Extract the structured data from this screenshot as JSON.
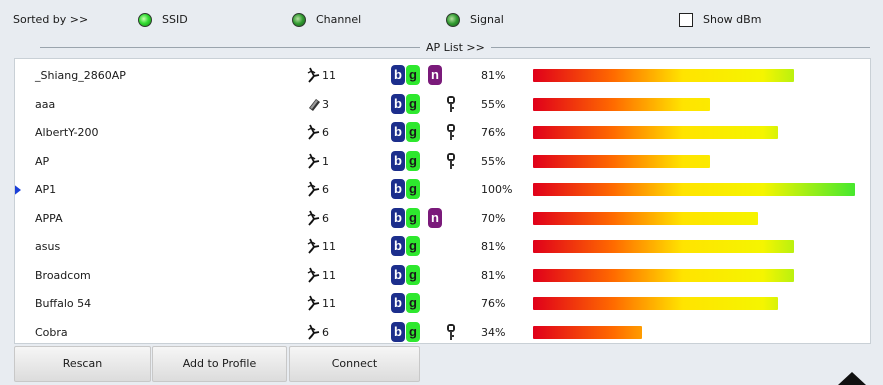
{
  "sortbar": {
    "label": "Sorted by >>",
    "ssid": "SSID",
    "channel": "Channel",
    "signal": "Signal",
    "show_dbm": "Show dBm",
    "ssid_selected": true,
    "show_dbm_checked": false
  },
  "ap_list_label": "AP List >>",
  "colors": {
    "b_badge": "#1c2e8c",
    "g_badge": "#2ee82e",
    "n_badge": "#7a1a7a",
    "selected_arrow": "#1a3fd8"
  },
  "rows": [
    {
      "ssid": "_Shiang_2860AP",
      "channel": "11",
      "channel_icon": "wireless-ap-icon",
      "b": true,
      "g": true,
      "n": true,
      "secured": false,
      "signal": "81%",
      "signal_value": 81,
      "selected": false
    },
    {
      "ssid": "aaa",
      "channel": "3",
      "channel_icon": "adhoc-device-icon",
      "b": true,
      "g": true,
      "n": false,
      "secured": true,
      "signal": "55%",
      "signal_value": 55,
      "selected": false
    },
    {
      "ssid": "AlbertY-200",
      "channel": "6",
      "channel_icon": "wireless-ap-icon",
      "b": true,
      "g": true,
      "n": false,
      "secured": true,
      "signal": "76%",
      "signal_value": 76,
      "selected": false
    },
    {
      "ssid": "AP",
      "channel": "1",
      "channel_icon": "wireless-ap-icon",
      "b": true,
      "g": true,
      "n": false,
      "secured": true,
      "signal": "55%",
      "signal_value": 55,
      "selected": false
    },
    {
      "ssid": "AP1",
      "channel": "6",
      "channel_icon": "wireless-ap-icon",
      "b": true,
      "g": true,
      "n": false,
      "secured": false,
      "signal": "100%",
      "signal_value": 100,
      "selected": true
    },
    {
      "ssid": "APPA",
      "channel": "6",
      "channel_icon": "wireless-ap-icon",
      "b": true,
      "g": true,
      "n": true,
      "secured": false,
      "signal": "70%",
      "signal_value": 70,
      "selected": false
    },
    {
      "ssid": "asus",
      "channel": "11",
      "channel_icon": "wireless-ap-icon",
      "b": true,
      "g": true,
      "n": false,
      "secured": false,
      "signal": "81%",
      "signal_value": 81,
      "selected": false
    },
    {
      "ssid": "Broadcom",
      "channel": "11",
      "channel_icon": "wireless-ap-icon",
      "b": true,
      "g": true,
      "n": false,
      "secured": false,
      "signal": "81%",
      "signal_value": 81,
      "selected": false
    },
    {
      "ssid": "Buffalo 54",
      "channel": "11",
      "channel_icon": "wireless-ap-icon",
      "b": true,
      "g": true,
      "n": false,
      "secured": false,
      "signal": "76%",
      "signal_value": 76,
      "selected": false
    },
    {
      "ssid": "Cobra",
      "channel": "6",
      "channel_icon": "wireless-ap-icon",
      "b": true,
      "g": true,
      "n": false,
      "secured": true,
      "signal": "34%",
      "signal_value": 34,
      "selected": false
    }
  ],
  "buttons": {
    "rescan": "Rescan",
    "add_to_profile": "Add to Profile",
    "connect": "Connect"
  }
}
